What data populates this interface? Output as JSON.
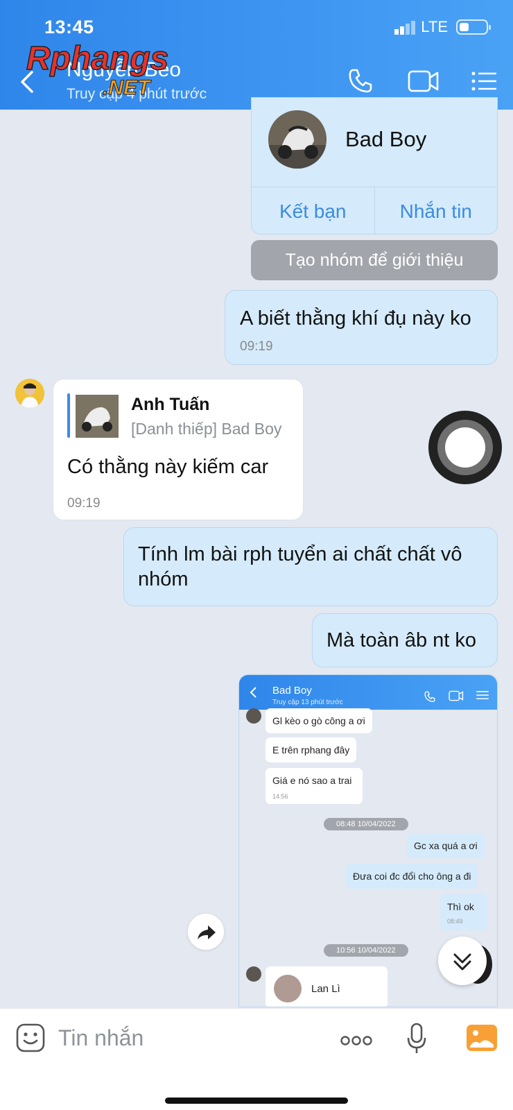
{
  "status_bar": {
    "time": "13:45",
    "network": "LTE"
  },
  "header": {
    "contact_name": "Nguyễn Béo",
    "contact_status": "Truy cập 4 phút trước",
    "watermark": "Rphangs.NET",
    "icons": [
      "back-icon",
      "phone-icon",
      "video-call-icon",
      "list-menu-icon"
    ]
  },
  "contact_card": {
    "name": "Bad Boy",
    "add_friend_label": "Kết bạn",
    "message_label": "Nhắn tin",
    "intro_group_label": "Tạo nhóm để giới thiệu"
  },
  "messages": [
    {
      "id": "m1",
      "from": "me",
      "text": "A biết thằng khí đụ này ko",
      "time": "09:19"
    },
    {
      "id": "m2",
      "from": "them",
      "quote_name": "Anh Tuấn",
      "quote_sub": "[Danh thiếp] Bad Boy",
      "text": "Có thằng này kiếm car",
      "time": "09:19"
    },
    {
      "id": "m3",
      "from": "me",
      "text": "Tính lm bài rph tuyển ai chất chất vô nhóm"
    },
    {
      "id": "m4",
      "from": "me",
      "text": "Mà toàn âb nt ko"
    }
  ],
  "embedded_screenshot": {
    "contact_name": "Bad Boy",
    "contact_status": "Truy cập 13 phút trước",
    "messages": [
      {
        "from": "them",
        "text": "Gl kèo o gò công a ơi"
      },
      {
        "from": "them",
        "text": "E trên rphang đây"
      },
      {
        "from": "them",
        "text": "Giá e nó sao a trai",
        "time": "14:56"
      },
      {
        "from": "date",
        "text": "08:48 10/04/2022"
      },
      {
        "from": "me",
        "text": "Gc xa quá a ơi"
      },
      {
        "from": "me",
        "text": "Đưa coi đc đổi cho ông a đi"
      },
      {
        "from": "me",
        "text": "Thì ok",
        "time": "08:49"
      },
      {
        "from": "date",
        "text": "10:56 10/04/2022"
      }
    ],
    "card_name": "Lan Lì"
  },
  "input_bar": {
    "placeholder": "Tin nhắn"
  },
  "colors": {
    "header": "#3a8fee",
    "accent": "#3b8be2",
    "bubble_me": "#d5ebfb",
    "bubble_them": "#ffffff",
    "background": "#e3e8f1"
  }
}
